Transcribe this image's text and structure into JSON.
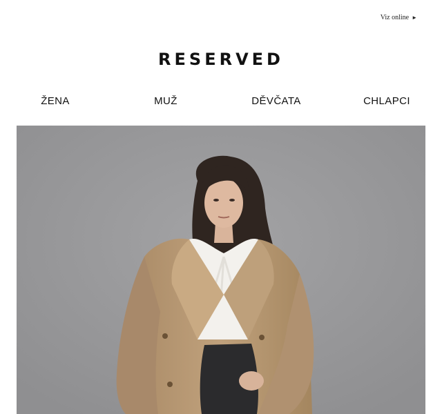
{
  "header": {
    "view_online": "Viz online",
    "arrow_icon": "play-arrow-icon",
    "logo": "RESERVED"
  },
  "nav": {
    "items": [
      {
        "label": "ŽENA"
      },
      {
        "label": "MUŽ"
      },
      {
        "label": "DĚVČATA"
      },
      {
        "label": "CHLAPCI"
      }
    ]
  },
  "hero": {
    "image": "woman-in-beige-trench-coat-photo",
    "background_color": "#9b9b9d",
    "coat_color": "#b89a75",
    "blouse_color": "#f3f1ed",
    "skirt_color": "#2b2b2d",
    "hair_color": "#2f2520"
  }
}
